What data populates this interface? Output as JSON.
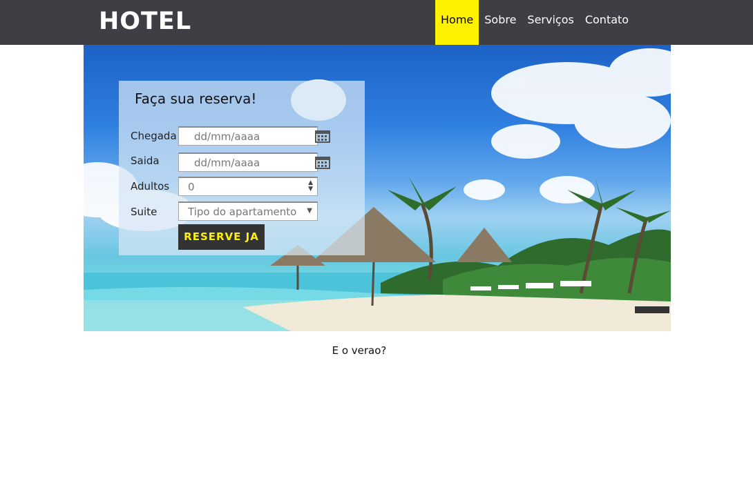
{
  "header": {
    "logo": "HOTEL",
    "nav": [
      {
        "label": "Home",
        "active": true
      },
      {
        "label": "Sobre",
        "active": false
      },
      {
        "label": "Serviços",
        "active": false
      },
      {
        "label": "Contato",
        "active": false
      }
    ]
  },
  "booking": {
    "title": "Faça sua reserva!",
    "checkin": {
      "label": "Chegada",
      "placeholder": "dd/mm/aaaa"
    },
    "checkout": {
      "label": "Saida",
      "placeholder": "dd/mm/aaaa"
    },
    "adults": {
      "label": "Adultos",
      "value": "0"
    },
    "suite": {
      "label": "Suite",
      "placeholder": "Tipo do apartamento"
    },
    "submit": "RESERVE JA"
  },
  "caption": "E o verao?",
  "colors": {
    "topbar": "#403e45",
    "active_nav": "#fff200",
    "button_bg": "#333333",
    "button_text": "#fff200"
  }
}
